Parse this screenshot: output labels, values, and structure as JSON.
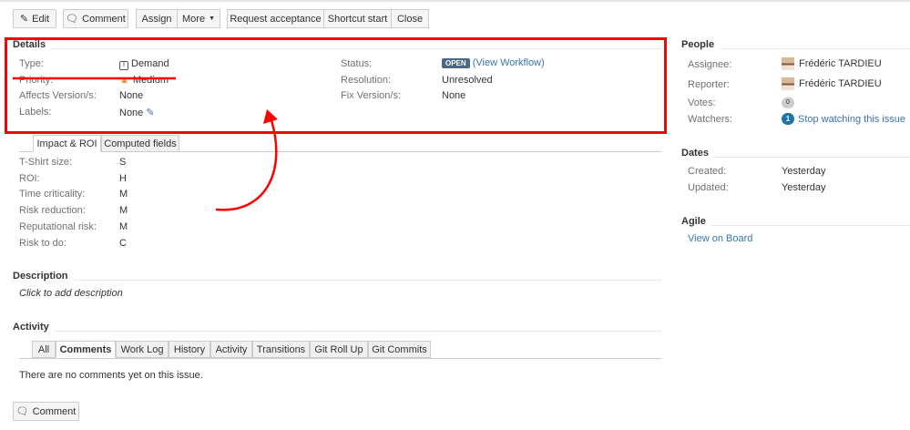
{
  "toolbar": {
    "edit": "Edit",
    "comment": "Comment",
    "assign": "Assign",
    "more": "More",
    "request_acceptance": "Request acceptance",
    "shortcut_start": "Shortcut start",
    "close": "Close"
  },
  "details": {
    "heading": "Details",
    "type_label": "Type:",
    "type_value": "Demand",
    "priority_label": "Priority:",
    "priority_value": "Medium",
    "affects_label": "Affects Version/s:",
    "affects_value": "None",
    "labels_label": "Labels:",
    "labels_value": "None",
    "status_label": "Status:",
    "status_value": "OPEN",
    "view_workflow": "(View Workflow)",
    "resolution_label": "Resolution:",
    "resolution_value": "Unresolved",
    "fix_label": "Fix Version/s:",
    "fix_value": "None"
  },
  "custom_tabs": [
    {
      "label": "Impact & ROI"
    },
    {
      "label": "Computed fields"
    }
  ],
  "custom_fields": [
    {
      "label": "T-Shirt size:",
      "value": "S"
    },
    {
      "label": "ROI:",
      "value": "H"
    },
    {
      "label": "Time criticality:",
      "value": "M"
    },
    {
      "label": "Risk reduction:",
      "value": "M"
    },
    {
      "label": "Reputational risk:",
      "value": "M"
    },
    {
      "label": "Risk to do:",
      "value": "C"
    }
  ],
  "description": {
    "heading": "Description",
    "placeholder": "Click to add description"
  },
  "activity": {
    "heading": "Activity",
    "tabs": [
      {
        "label": "All"
      },
      {
        "label": "Comments"
      },
      {
        "label": "Work Log"
      },
      {
        "label": "History"
      },
      {
        "label": "Activity"
      },
      {
        "label": "Transitions"
      },
      {
        "label": "Git Roll Up"
      },
      {
        "label": "Git Commits"
      }
    ],
    "empty": "There are no comments yet on this issue.",
    "comment_button": "Comment"
  },
  "people": {
    "heading": "People",
    "assignee_label": "Assignee:",
    "assignee": "Frédéric TARDIEU",
    "reporter_label": "Reporter:",
    "reporter": "Frédéric TARDIEU",
    "votes_label": "Votes:",
    "votes": "0",
    "watchers_label": "Watchers:",
    "watchers": "1",
    "stop_watching": "Stop watching this issue"
  },
  "dates": {
    "heading": "Dates",
    "created_label": "Created:",
    "created": "Yesterday",
    "updated_label": "Updated:",
    "updated": "Yesterday"
  },
  "agile": {
    "heading": "Agile",
    "view_on_board": "View on Board"
  },
  "colors": {
    "annotation": "#ff0000",
    "link": "#3b73af",
    "status_badge": "#4a6785",
    "watch_badge": "#1e73a8"
  }
}
